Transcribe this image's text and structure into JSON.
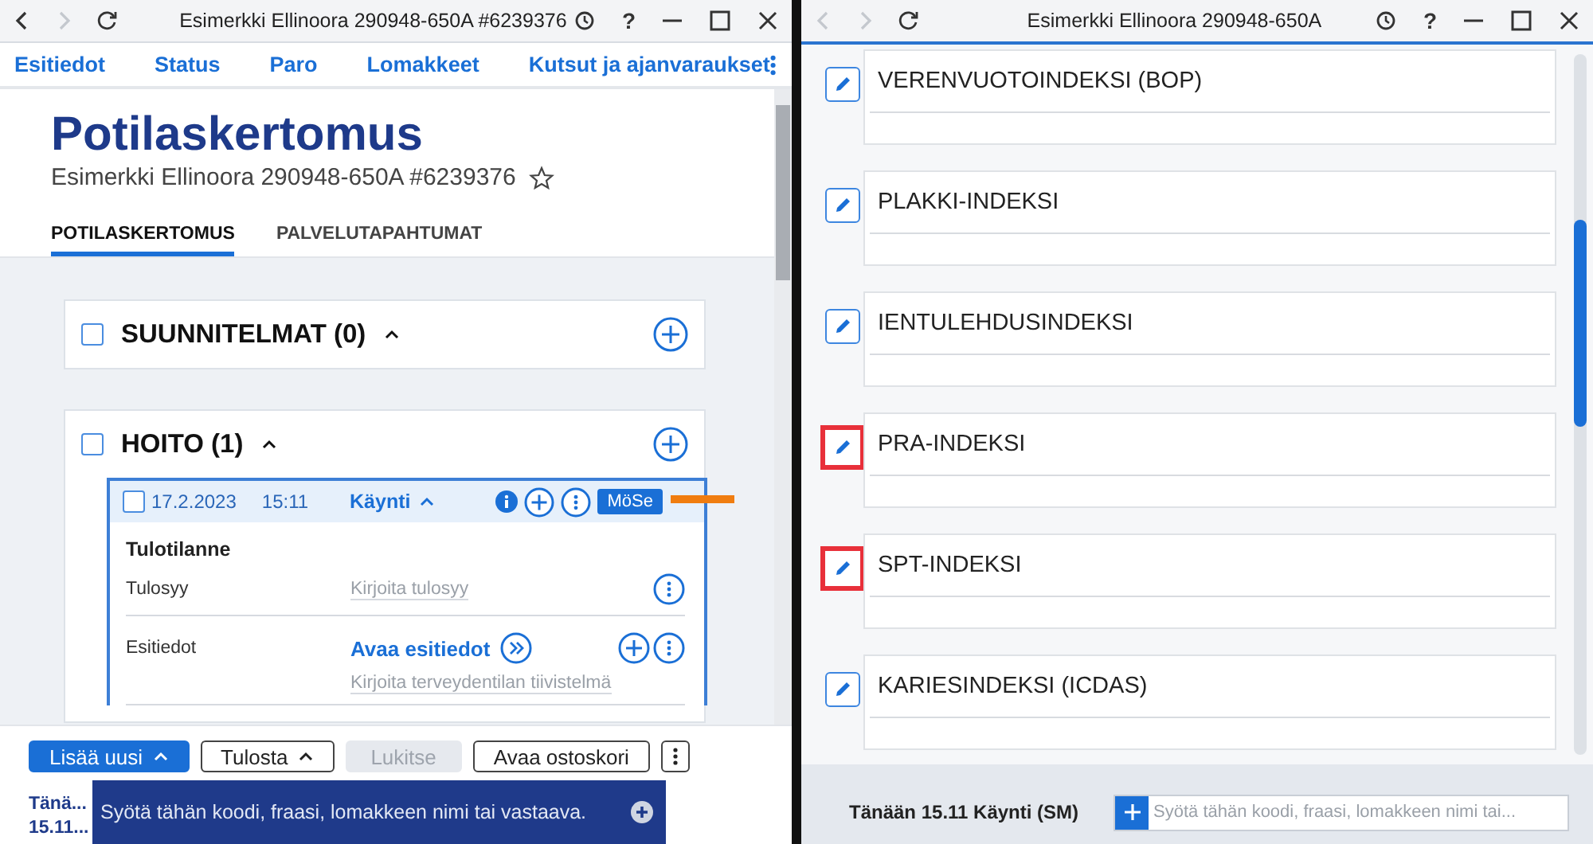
{
  "left_window": {
    "titlebar": {
      "title": "Esimerkki Ellinoora 290948-650A #6239376",
      "back_disabled": false,
      "forward_disabled": true,
      "help": "?"
    },
    "nav": [
      "Esitiedot",
      "Status",
      "Paro",
      "Lomakkeet",
      "Kutsut ja ajanvaraukset"
    ],
    "page_title": "Potilaskertomus",
    "patient": "Esimerkki Ellinoora 290948-650A #6239376",
    "favorite": false,
    "tabs": [
      {
        "label": "POTILASKERTOMUS",
        "selected": true
      },
      {
        "label": "PALVELUTAPAHTUMAT",
        "selected": false
      }
    ],
    "sections": [
      {
        "title": "SUUNNITELMAT (0)",
        "checked": false,
        "expanded": true
      },
      {
        "title": "HOITO (1)",
        "checked": false,
        "expanded": true,
        "entry": {
          "checked": false,
          "date": "17.2.2023",
          "time": "15:11",
          "type": "Käynti",
          "expanded": true,
          "tag": "MöSe",
          "callout": true,
          "heading": "Tulotilanne",
          "fields": [
            {
              "label": "Tulosyy",
              "kind": "text",
              "placeholder": "Kirjoita tulosyy"
            },
            {
              "label": "Esitiedot",
              "kind": "link",
              "link": "Avaa esitiedot",
              "placeholder": "Kirjoita terveydentilan tiivistelmä"
            }
          ]
        }
      }
    ],
    "toolbar": [
      {
        "kind": "primary",
        "label": "Lisää uusi",
        "caret": true
      },
      {
        "kind": "outline",
        "label": "Tulosta",
        "caret": true
      },
      {
        "kind": "disabled",
        "label": "Lukitse",
        "caret": false
      },
      {
        "kind": "outline",
        "label": "Avaa ostoskori",
        "caret": false
      },
      {
        "kind": "more",
        "caret": false
      }
    ],
    "status": {
      "day": "Tänä...",
      "date": "15.11...",
      "placeholder": "Syötä tähän koodi, fraasi, lomakkeen nimi tai vastaava."
    }
  },
  "right_window": {
    "titlebar": {
      "title": "Esimerkki Ellinoora 290948-650A",
      "back_disabled": true,
      "forward_disabled": true,
      "help": "?"
    },
    "indices": [
      {
        "label": "VERENVUOTOINDEKSI (BOP)",
        "highlighted": false
      },
      {
        "label": "PLAKKI-INDEKSI",
        "highlighted": false
      },
      {
        "label": "IENTULEHDUSINDEKSI",
        "highlighted": false
      },
      {
        "label": "PRA-INDEKSI",
        "highlighted": true
      },
      {
        "label": "SPT-INDEKSI",
        "highlighted": true
      },
      {
        "label": "KARIESINDEKSI (ICDAS)",
        "highlighted": false
      }
    ],
    "status": {
      "context": "Tänään 15.11 Käynti (SM)",
      "placeholder": "Syötä tähän koodi, fraasi, lomakkeen nimi tai..."
    }
  }
}
